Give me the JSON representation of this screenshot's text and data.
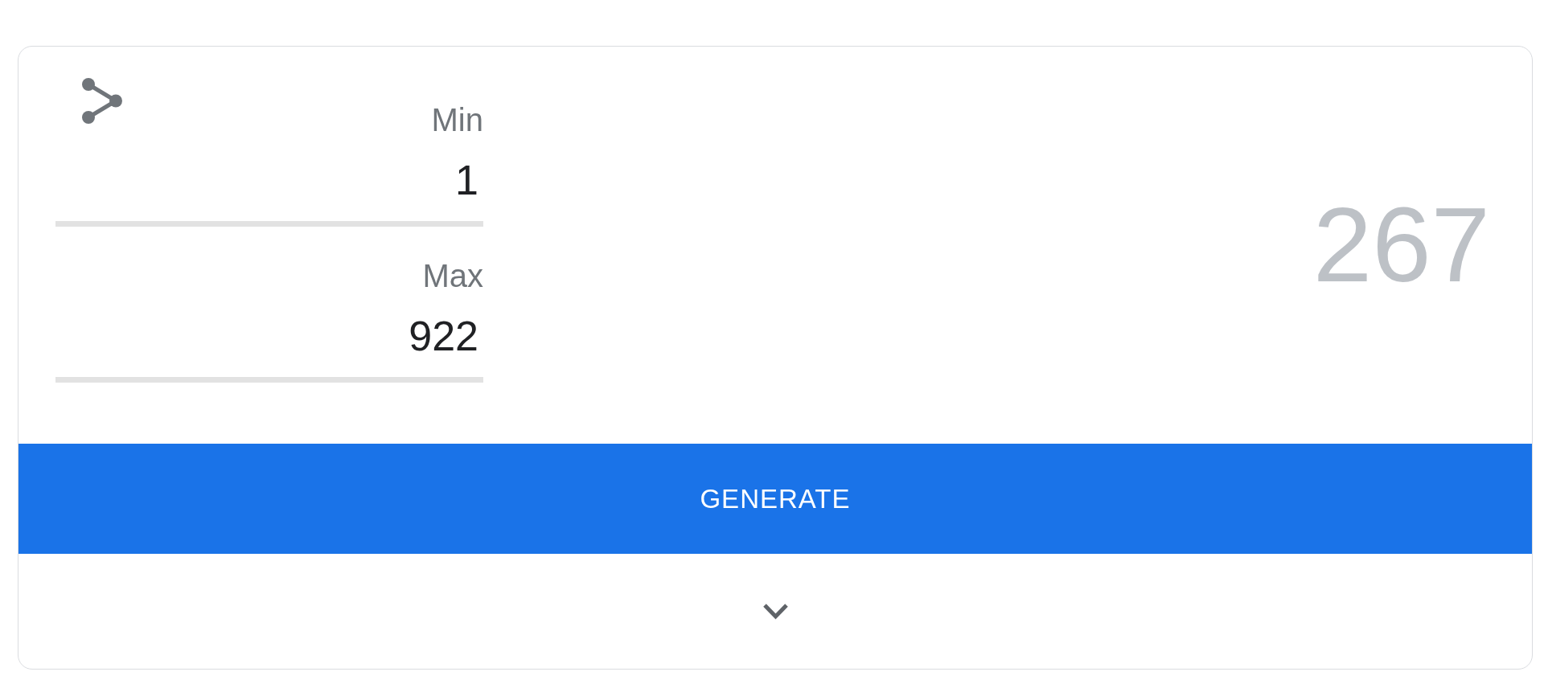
{
  "fields": [
    {
      "label": "Min",
      "value": "1"
    },
    {
      "label": "Max",
      "value": "922"
    }
  ],
  "result": "267",
  "button": {
    "label": "GENERATE"
  },
  "footer": {
    "expanded": false
  }
}
